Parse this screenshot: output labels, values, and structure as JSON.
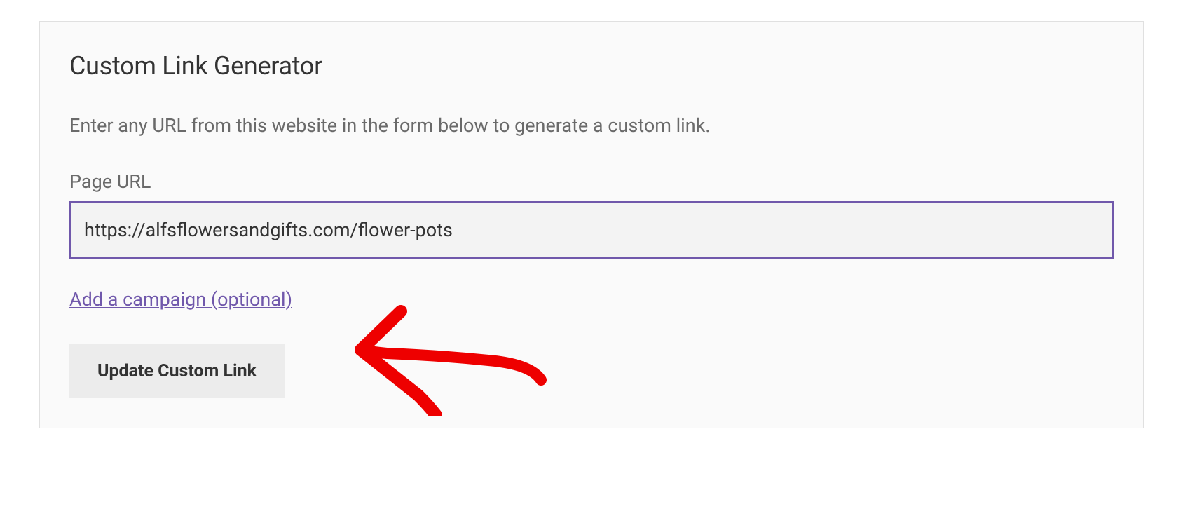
{
  "panel": {
    "title": "Custom Link Generator",
    "instruction": "Enter any URL from this website in the form below to generate a custom link.",
    "url_label": "Page URL",
    "url_value": "https://alfsflowersandgifts.com/flower-pots",
    "campaign_link_text": "Add a campaign (optional)",
    "button_label": "Update Custom Link"
  }
}
